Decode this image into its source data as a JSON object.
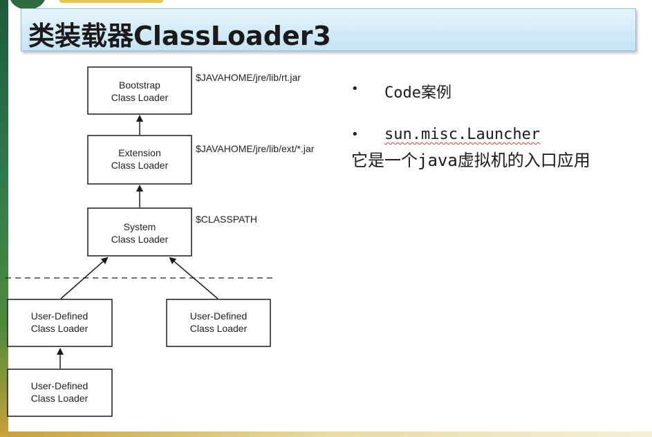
{
  "slide": {
    "title": "类装载器ClassLoader3"
  },
  "diagram": {
    "boxes": {
      "bootstrap": [
        "Bootstrap",
        "Class Loader"
      ],
      "extension": [
        "Extension",
        "Class Loader"
      ],
      "system": [
        "System",
        "Class Loader"
      ],
      "user1": [
        "User-Defined",
        "Class Loader"
      ],
      "user2": [
        "User-Defined",
        "Class Loader"
      ],
      "user3": [
        "User-Defined",
        "Class Loader"
      ]
    },
    "paths": {
      "bootstrap": "$JAVAHOME/jre/lib/rt.jar",
      "extension": "$JAVAHOME/jre/lib/ext/*.jar",
      "system": "$CLASSPATH"
    }
  },
  "bullets": [
    {
      "dot": "•",
      "text": "Code案例"
    },
    {
      "dot": "•",
      "text": "sun.misc.Launcher",
      "sub": "它是一个java虚拟机的入口应用"
    }
  ]
}
